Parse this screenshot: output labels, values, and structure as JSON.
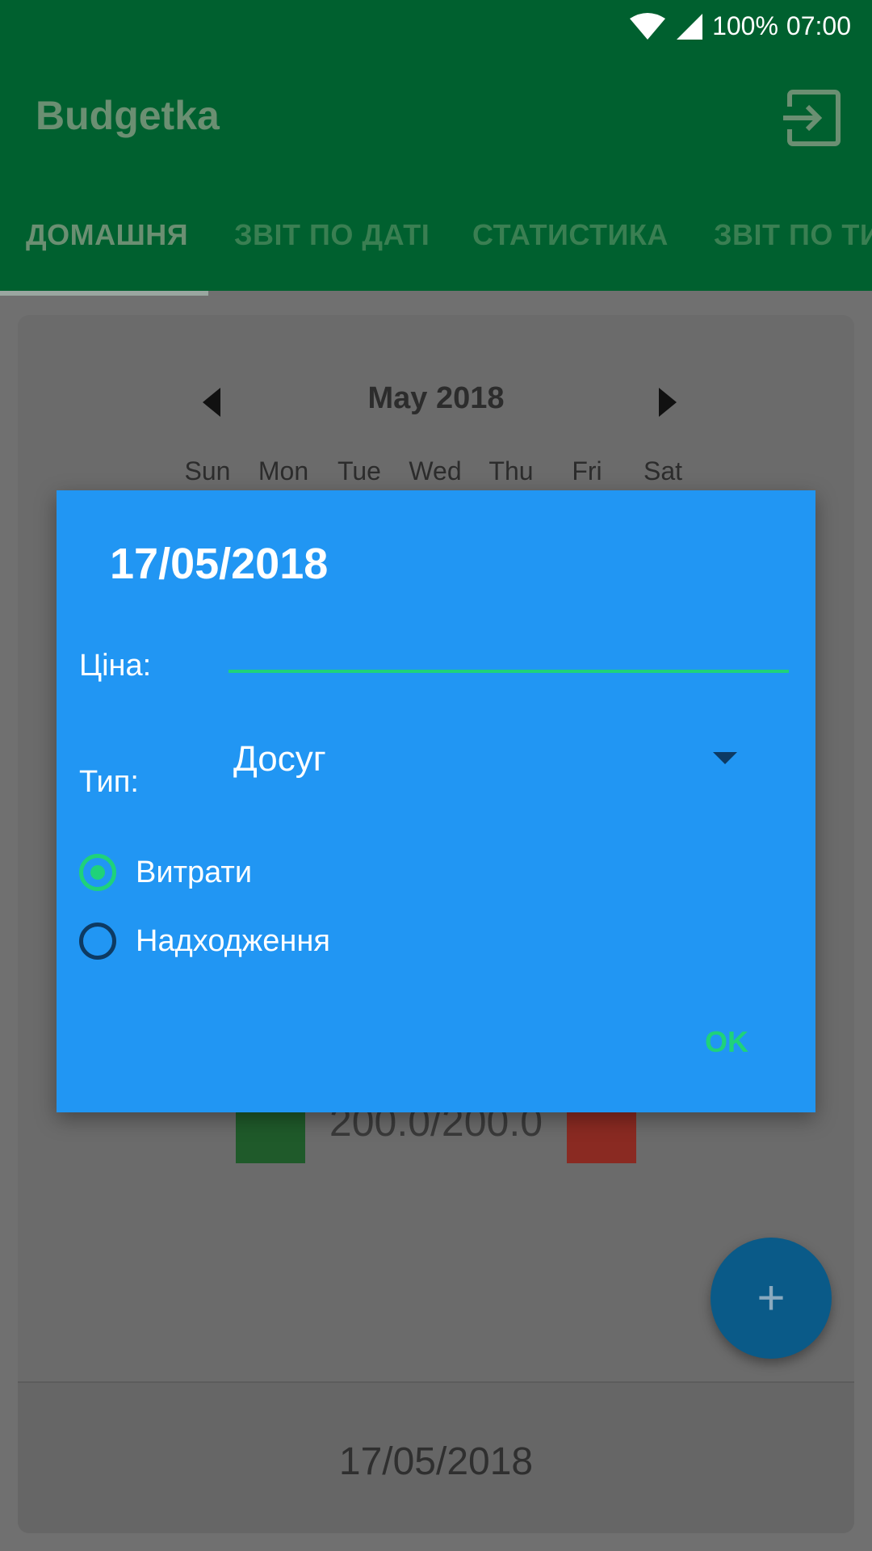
{
  "status_bar": {
    "battery": "100%",
    "time": "07:00",
    "icons": [
      "wifi-icon",
      "signal-icon"
    ]
  },
  "app": {
    "title": "Budgetka",
    "logout_icon": "logout-icon"
  },
  "tabs": [
    {
      "label": "ДОМАШНЯ",
      "active": true
    },
    {
      "label": "ЗВІТ ПО ДАТІ",
      "active": false
    },
    {
      "label": "СТАТИСТИКА",
      "active": false
    },
    {
      "label": "ЗВІТ ПО ТИ",
      "active": false
    }
  ],
  "calendar": {
    "month": "May 2018",
    "days_of_week": [
      "Sun",
      "Mon",
      "Tue",
      "Wed",
      "Thu",
      "Fri",
      "Sat"
    ]
  },
  "budget": {
    "value": "200.0/200.0"
  },
  "bottom": {
    "date": "17/05/2018"
  },
  "dialog": {
    "title": "17/05/2018",
    "price_label": "Ціна:",
    "price_value": "",
    "type_label": "Тип:",
    "type_value": "Досуг",
    "radio_options": [
      {
        "label": "Витрати",
        "checked": true
      },
      {
        "label": "Надходження",
        "checked": false
      }
    ],
    "ok_label": "OK"
  },
  "colors": {
    "primary_dark": "#00602F",
    "dialog": "#2196F3",
    "accent": "#1fd27a"
  }
}
